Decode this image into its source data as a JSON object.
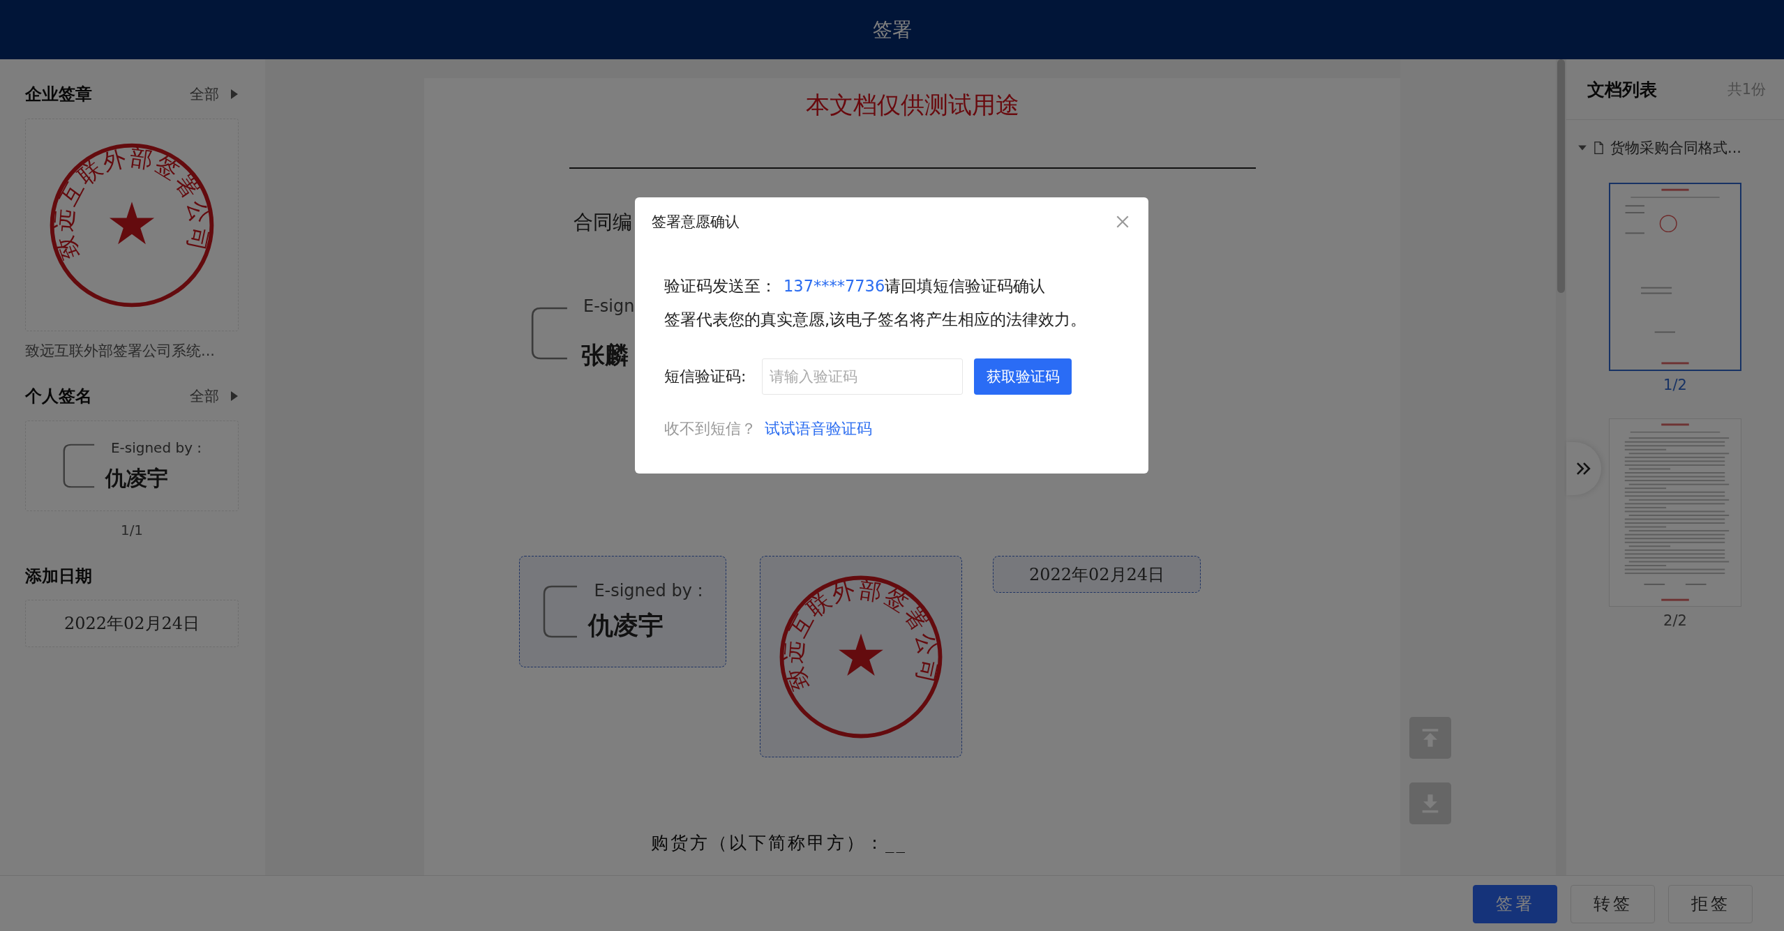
{
  "header": {
    "title": "签署"
  },
  "company_seal": {
    "heading": "企业签章",
    "all_link": "全部",
    "seal_text": "致远互联外部签署公司",
    "caption": "致远互联外部签署公司系统..."
  },
  "personal_signature": {
    "heading": "个人签名",
    "all_link": "全部",
    "signed_by": "E-signed by :",
    "name": "仇凌宇",
    "pager": "1/1"
  },
  "add_date": {
    "heading": "添加日期",
    "date": "2022年02月24日"
  },
  "document": {
    "header_note": "本文档仅供测试用途",
    "contract_no": "合同编",
    "signer_label": "E-sign",
    "signer_name": "张麟",
    "placed_signature": {
      "signed_by": "E-signed by :",
      "name": "仇凌宇"
    },
    "placed_seal": {
      "seal_text": "致远互联外部签署公司"
    },
    "placed_date": "2022年02月24日",
    "buyer_line": "购货方（以下简称甲方）：__"
  },
  "doc_list": {
    "title": "文档列表",
    "count": "共1份",
    "file": {
      "name": "货物采购合同格式...",
      "expanded": true
    },
    "pages": [
      {
        "label": "1/2",
        "selected": true
      },
      {
        "label": "2/2",
        "selected": false
      }
    ]
  },
  "actions": [
    {
      "label": "签署",
      "kind": "primary"
    },
    {
      "label": "转签",
      "kind": "default"
    },
    {
      "label": "拒签",
      "kind": "default"
    }
  ],
  "modal": {
    "title": "签署意愿确认",
    "sent_to_label": "验证码发送至：",
    "phone": "137****7736",
    "sent_to_suffix": "请回填短信验证码确认",
    "notice": "签署代表您的真实意愿,该电子签名将产生相应的法律效力。",
    "code_label": "短信验证码:",
    "code_placeholder": "请输入验证码",
    "get_code_button": "获取验证码",
    "no_sms": "收不到短信？",
    "voice_link": "试试语音验证码"
  }
}
